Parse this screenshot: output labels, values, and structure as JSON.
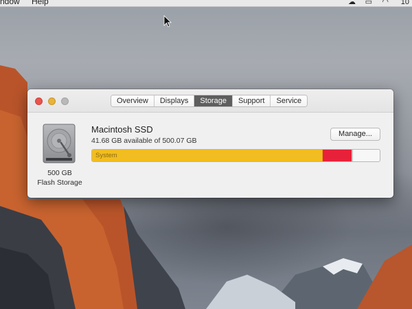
{
  "menubar": {
    "items": [
      "ndow",
      "Help"
    ],
    "icons": [
      "cloud-icon",
      "airplay-icon",
      "wifi-icon"
    ],
    "clock": "10"
  },
  "window": {
    "tabs": [
      {
        "label": "Overview",
        "active": false
      },
      {
        "label": "Displays",
        "active": false
      },
      {
        "label": "Storage",
        "active": true
      },
      {
        "label": "Support",
        "active": false
      },
      {
        "label": "Service",
        "active": false
      }
    ],
    "drive": {
      "size_label": "500 GB",
      "kind_label": "Flash Storage"
    },
    "volume": {
      "name": "Macintosh SSD",
      "available_text": "41.68 GB available of 500.07 GB",
      "manage_label": "Manage..."
    },
    "storage_bar": {
      "segments": [
        {
          "label": "System",
          "fraction": 0.803,
          "color": "#f1bd20"
        },
        {
          "label": "",
          "fraction": 0.098,
          "color": "#e8213a"
        },
        {
          "label": "",
          "fraction": 0.006,
          "color": "#c9c4c4"
        }
      ]
    }
  }
}
